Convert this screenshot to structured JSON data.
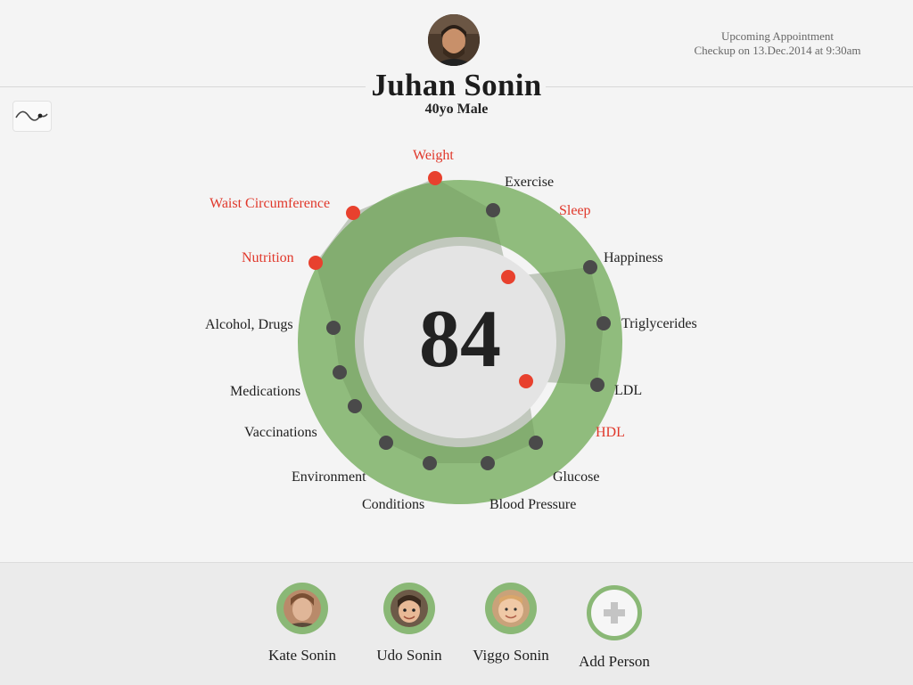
{
  "person": {
    "name": "Juhan Sonin",
    "subtitle": "40yo Male"
  },
  "appointment": {
    "title": "Upcoming Appointment",
    "detail": "Checkup on 13.Dec.2014 at 9:30am"
  },
  "score": "84",
  "colors": {
    "accent_green": "#8ab876",
    "alert_red": "#e8412e",
    "dot_dark": "#4a4a4a"
  },
  "metrics": [
    {
      "label": "Weight",
      "alert": true
    },
    {
      "label": "Exercise",
      "alert": false
    },
    {
      "label": "Sleep",
      "alert": true
    },
    {
      "label": "Happiness",
      "alert": false
    },
    {
      "label": "Triglycerides",
      "alert": false
    },
    {
      "label": "LDL",
      "alert": false
    },
    {
      "label": "HDL",
      "alert": true
    },
    {
      "label": "Glucose",
      "alert": false
    },
    {
      "label": "Blood Pressure",
      "alert": false
    },
    {
      "label": "Conditions",
      "alert": false
    },
    {
      "label": "Environment",
      "alert": false
    },
    {
      "label": "Vaccinations",
      "alert": false
    },
    {
      "label": "Medications",
      "alert": false
    },
    {
      "label": "Alcohol, Drugs",
      "alert": false
    },
    {
      "label": "Nutrition",
      "alert": true
    },
    {
      "label": "Waist Circumference",
      "alert": true
    }
  ],
  "family": [
    {
      "name": "Kate Sonin"
    },
    {
      "name": "Udo Sonin"
    },
    {
      "name": "Viggo Sonin"
    }
  ],
  "add_person_label": "Add Person",
  "icons": {
    "trend": "trend-line-icon",
    "add": "plus-icon"
  }
}
